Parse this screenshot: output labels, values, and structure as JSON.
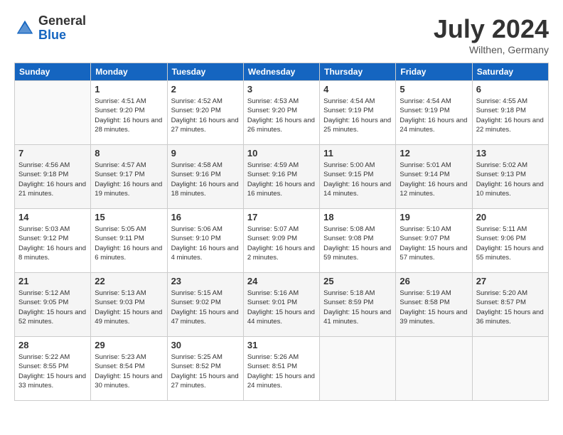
{
  "header": {
    "logo_general": "General",
    "logo_blue": "Blue",
    "month_year": "July 2024",
    "location": "Wilthen, Germany"
  },
  "weekdays": [
    "Sunday",
    "Monday",
    "Tuesday",
    "Wednesday",
    "Thursday",
    "Friday",
    "Saturday"
  ],
  "weeks": [
    [
      {
        "day": "",
        "sunrise": "",
        "sunset": "",
        "daylight": ""
      },
      {
        "day": "1",
        "sunrise": "Sunrise: 4:51 AM",
        "sunset": "Sunset: 9:20 PM",
        "daylight": "Daylight: 16 hours and 28 minutes."
      },
      {
        "day": "2",
        "sunrise": "Sunrise: 4:52 AM",
        "sunset": "Sunset: 9:20 PM",
        "daylight": "Daylight: 16 hours and 27 minutes."
      },
      {
        "day": "3",
        "sunrise": "Sunrise: 4:53 AM",
        "sunset": "Sunset: 9:20 PM",
        "daylight": "Daylight: 16 hours and 26 minutes."
      },
      {
        "day": "4",
        "sunrise": "Sunrise: 4:54 AM",
        "sunset": "Sunset: 9:19 PM",
        "daylight": "Daylight: 16 hours and 25 minutes."
      },
      {
        "day": "5",
        "sunrise": "Sunrise: 4:54 AM",
        "sunset": "Sunset: 9:19 PM",
        "daylight": "Daylight: 16 hours and 24 minutes."
      },
      {
        "day": "6",
        "sunrise": "Sunrise: 4:55 AM",
        "sunset": "Sunset: 9:18 PM",
        "daylight": "Daylight: 16 hours and 22 minutes."
      }
    ],
    [
      {
        "day": "7",
        "sunrise": "Sunrise: 4:56 AM",
        "sunset": "Sunset: 9:18 PM",
        "daylight": "Daylight: 16 hours and 21 minutes."
      },
      {
        "day": "8",
        "sunrise": "Sunrise: 4:57 AM",
        "sunset": "Sunset: 9:17 PM",
        "daylight": "Daylight: 16 hours and 19 minutes."
      },
      {
        "day": "9",
        "sunrise": "Sunrise: 4:58 AM",
        "sunset": "Sunset: 9:16 PM",
        "daylight": "Daylight: 16 hours and 18 minutes."
      },
      {
        "day": "10",
        "sunrise": "Sunrise: 4:59 AM",
        "sunset": "Sunset: 9:16 PM",
        "daylight": "Daylight: 16 hours and 16 minutes."
      },
      {
        "day": "11",
        "sunrise": "Sunrise: 5:00 AM",
        "sunset": "Sunset: 9:15 PM",
        "daylight": "Daylight: 16 hours and 14 minutes."
      },
      {
        "day": "12",
        "sunrise": "Sunrise: 5:01 AM",
        "sunset": "Sunset: 9:14 PM",
        "daylight": "Daylight: 16 hours and 12 minutes."
      },
      {
        "day": "13",
        "sunrise": "Sunrise: 5:02 AM",
        "sunset": "Sunset: 9:13 PM",
        "daylight": "Daylight: 16 hours and 10 minutes."
      }
    ],
    [
      {
        "day": "14",
        "sunrise": "Sunrise: 5:03 AM",
        "sunset": "Sunset: 9:12 PM",
        "daylight": "Daylight: 16 hours and 8 minutes."
      },
      {
        "day": "15",
        "sunrise": "Sunrise: 5:05 AM",
        "sunset": "Sunset: 9:11 PM",
        "daylight": "Daylight: 16 hours and 6 minutes."
      },
      {
        "day": "16",
        "sunrise": "Sunrise: 5:06 AM",
        "sunset": "Sunset: 9:10 PM",
        "daylight": "Daylight: 16 hours and 4 minutes."
      },
      {
        "day": "17",
        "sunrise": "Sunrise: 5:07 AM",
        "sunset": "Sunset: 9:09 PM",
        "daylight": "Daylight: 16 hours and 2 minutes."
      },
      {
        "day": "18",
        "sunrise": "Sunrise: 5:08 AM",
        "sunset": "Sunset: 9:08 PM",
        "daylight": "Daylight: 15 hours and 59 minutes."
      },
      {
        "day": "19",
        "sunrise": "Sunrise: 5:10 AM",
        "sunset": "Sunset: 9:07 PM",
        "daylight": "Daylight: 15 hours and 57 minutes."
      },
      {
        "day": "20",
        "sunrise": "Sunrise: 5:11 AM",
        "sunset": "Sunset: 9:06 PM",
        "daylight": "Daylight: 15 hours and 55 minutes."
      }
    ],
    [
      {
        "day": "21",
        "sunrise": "Sunrise: 5:12 AM",
        "sunset": "Sunset: 9:05 PM",
        "daylight": "Daylight: 15 hours and 52 minutes."
      },
      {
        "day": "22",
        "sunrise": "Sunrise: 5:13 AM",
        "sunset": "Sunset: 9:03 PM",
        "daylight": "Daylight: 15 hours and 49 minutes."
      },
      {
        "day": "23",
        "sunrise": "Sunrise: 5:15 AM",
        "sunset": "Sunset: 9:02 PM",
        "daylight": "Daylight: 15 hours and 47 minutes."
      },
      {
        "day": "24",
        "sunrise": "Sunrise: 5:16 AM",
        "sunset": "Sunset: 9:01 PM",
        "daylight": "Daylight: 15 hours and 44 minutes."
      },
      {
        "day": "25",
        "sunrise": "Sunrise: 5:18 AM",
        "sunset": "Sunset: 8:59 PM",
        "daylight": "Daylight: 15 hours and 41 minutes."
      },
      {
        "day": "26",
        "sunrise": "Sunrise: 5:19 AM",
        "sunset": "Sunset: 8:58 PM",
        "daylight": "Daylight: 15 hours and 39 minutes."
      },
      {
        "day": "27",
        "sunrise": "Sunrise: 5:20 AM",
        "sunset": "Sunset: 8:57 PM",
        "daylight": "Daylight: 15 hours and 36 minutes."
      }
    ],
    [
      {
        "day": "28",
        "sunrise": "Sunrise: 5:22 AM",
        "sunset": "Sunset: 8:55 PM",
        "daylight": "Daylight: 15 hours and 33 minutes."
      },
      {
        "day": "29",
        "sunrise": "Sunrise: 5:23 AM",
        "sunset": "Sunset: 8:54 PM",
        "daylight": "Daylight: 15 hours and 30 minutes."
      },
      {
        "day": "30",
        "sunrise": "Sunrise: 5:25 AM",
        "sunset": "Sunset: 8:52 PM",
        "daylight": "Daylight: 15 hours and 27 minutes."
      },
      {
        "day": "31",
        "sunrise": "Sunrise: 5:26 AM",
        "sunset": "Sunset: 8:51 PM",
        "daylight": "Daylight: 15 hours and 24 minutes."
      },
      {
        "day": "",
        "sunrise": "",
        "sunset": "",
        "daylight": ""
      },
      {
        "day": "",
        "sunrise": "",
        "sunset": "",
        "daylight": ""
      },
      {
        "day": "",
        "sunrise": "",
        "sunset": "",
        "daylight": ""
      }
    ]
  ]
}
